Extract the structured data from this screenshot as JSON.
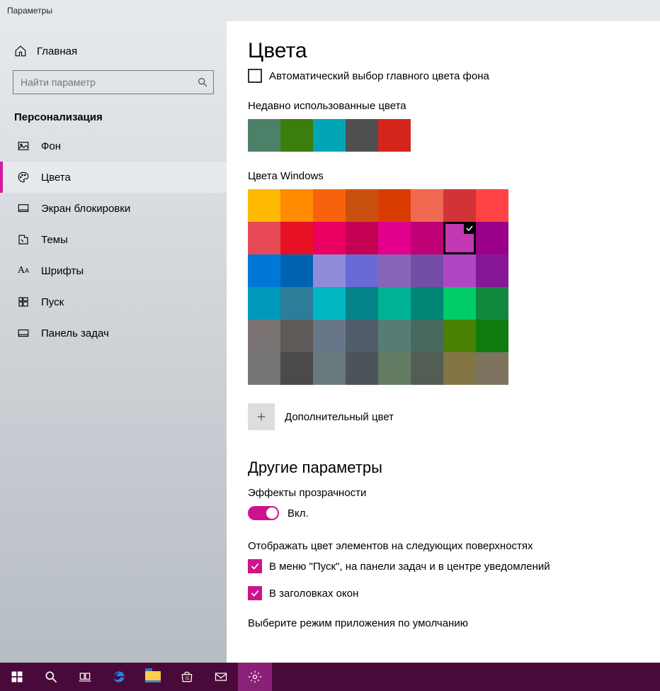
{
  "window": {
    "title": "Параметры"
  },
  "sidebar": {
    "home": "Главная",
    "search_placeholder": "Найти параметр",
    "group": "Персонализация",
    "items": [
      {
        "label": "Фон"
      },
      {
        "label": "Цвета",
        "active": true
      },
      {
        "label": "Экран блокировки"
      },
      {
        "label": "Темы"
      },
      {
        "label": "Шрифты"
      },
      {
        "label": "Пуск"
      },
      {
        "label": "Панель задач"
      }
    ]
  },
  "main": {
    "title": "Цвета",
    "auto_pick_label": "Автоматический выбор главного цвета фона",
    "recent": {
      "label": "Недавно использованные цвета",
      "colors": [
        "#4d8069",
        "#3b7e0e",
        "#00a6b5",
        "#4f4f4f",
        "#d4251d"
      ]
    },
    "windows_colors": {
      "label": "Цвета Windows",
      "selected_index": 14,
      "colors": [
        "#ffb900",
        "#ff8c00",
        "#f7630c",
        "#ca5010",
        "#da3b01",
        "#ef6950",
        "#d13438",
        "#ff4343",
        "#e74856",
        "#e81123",
        "#ea005e",
        "#c30052",
        "#e3008c",
        "#bf0077",
        "#c239b3",
        "#9a0089",
        "#0078d7",
        "#0063b1",
        "#8e8cd8",
        "#6b69d6",
        "#8764b8",
        "#744da9",
        "#b146c2",
        "#881798",
        "#0099bc",
        "#2d7d9a",
        "#00b7c3",
        "#038387",
        "#00b294",
        "#018574",
        "#00cc6a",
        "#10893e",
        "#7a7574",
        "#5d5a58",
        "#68768a",
        "#515c6b",
        "#567c73",
        "#486860",
        "#498205",
        "#107c10",
        "#767676",
        "#4c4a48",
        "#69797e",
        "#4a5459",
        "#647c64",
        "#525e54",
        "#847545",
        "#7e735f"
      ]
    },
    "custom_color_label": "Дополнительный цвет",
    "other_params_title": "Другие параметры",
    "transparency": {
      "label": "Эффекты прозрачности",
      "state_label": "Вкл."
    },
    "surfaces": {
      "label": "Отображать цвет элементов на следующих поверхностях",
      "options": [
        "В меню \"Пуск\", на панели задач и в центре уведомлений",
        "В заголовках окон"
      ]
    },
    "app_mode_label": "Выберите режим приложения по умолчанию"
  }
}
